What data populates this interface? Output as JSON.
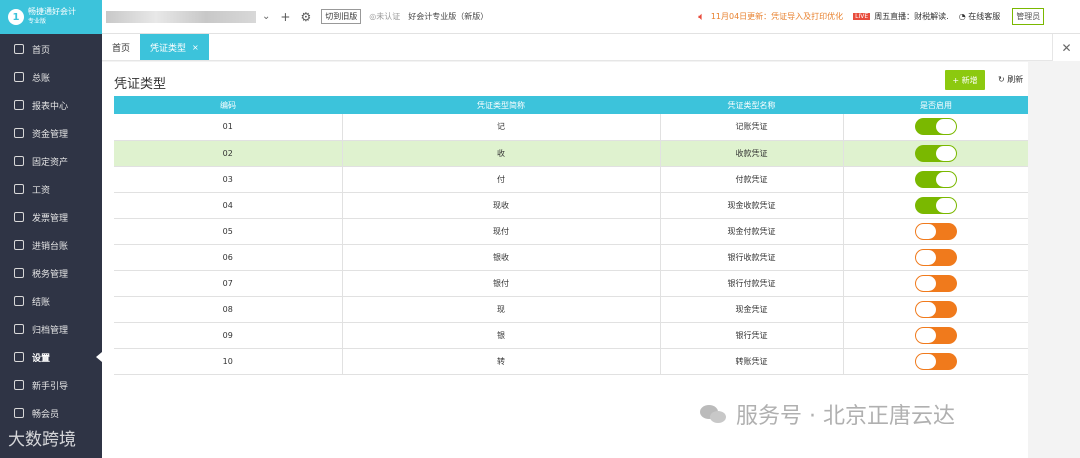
{
  "app": {
    "logo_mark": "1",
    "logo_title": "畅捷通好会计",
    "logo_sub": "专业版"
  },
  "sidebar": {
    "items": [
      {
        "label": "首页",
        "icon": "home-icon"
      },
      {
        "label": "总账",
        "icon": "ledger-icon"
      },
      {
        "label": "报表中心",
        "icon": "chart-icon"
      },
      {
        "label": "资金管理",
        "icon": "money-icon"
      },
      {
        "label": "固定资产",
        "icon": "asset-icon"
      },
      {
        "label": "工资",
        "icon": "salary-icon"
      },
      {
        "label": "发票管理",
        "icon": "invoice-icon"
      },
      {
        "label": "进销台账",
        "icon": "inventory-icon"
      },
      {
        "label": "税务管理",
        "icon": "tax-icon"
      },
      {
        "label": "结账",
        "icon": "close-books-icon"
      },
      {
        "label": "归档管理",
        "icon": "archive-icon"
      },
      {
        "label": "设置",
        "icon": "gear-icon",
        "active": true
      },
      {
        "label": "新手引导",
        "icon": "guide-icon"
      },
      {
        "label": "畅会员",
        "icon": "vip-icon"
      }
    ],
    "watermark": "大数跨境"
  },
  "topbar": {
    "switch_label": "切到旧版",
    "cert_label": "未认证",
    "edition_label": "好会计专业版（新版）",
    "announcement": "11月04日更新：凭证导入及打印优化",
    "live_tag": "LIVE",
    "live_label": "周五直播：财税解读.",
    "service_label": "在线客服",
    "admin_label": "管理员"
  },
  "tabs": [
    {
      "label": "首页",
      "active": false
    },
    {
      "label": "凭证类型",
      "active": true,
      "closable": true
    }
  ],
  "page": {
    "title": "凭证类型",
    "add_label": "+ 新增",
    "refresh_label": "刷新"
  },
  "table": {
    "headers": [
      "编码",
      "凭证类型简称",
      "凭证类型名称",
      "是否启用"
    ],
    "rows": [
      {
        "code": "01",
        "short": "记",
        "name": "记账凭证",
        "enabled": true
      },
      {
        "code": "02",
        "short": "收",
        "name": "收款凭证",
        "enabled": true
      },
      {
        "code": "03",
        "short": "付",
        "name": "付款凭证",
        "enabled": true
      },
      {
        "code": "04",
        "short": "现收",
        "name": "现金收款凭证",
        "enabled": true
      },
      {
        "code": "05",
        "short": "现付",
        "name": "现金付款凭证",
        "enabled": false
      },
      {
        "code": "06",
        "short": "银收",
        "name": "银行收款凭证",
        "enabled": false
      },
      {
        "code": "07",
        "short": "银付",
        "name": "银行付款凭证",
        "enabled": false
      },
      {
        "code": "08",
        "short": "现",
        "name": "现金凭证",
        "enabled": false
      },
      {
        "code": "09",
        "short": "银",
        "name": "银行凭证",
        "enabled": false
      },
      {
        "code": "10",
        "short": "转",
        "name": "转账凭证",
        "enabled": false
      }
    ],
    "highlighted_row": 1
  },
  "watermark_right": "服务号 · 北京正唐云达",
  "colors": {
    "accent": "#3cc3db",
    "sidebar_bg": "#2f3445",
    "toggle_on": "#7ab800",
    "toggle_off": "#f07a1c",
    "add_button": "#8cc90f",
    "highlight_row": "#dff2cf"
  }
}
